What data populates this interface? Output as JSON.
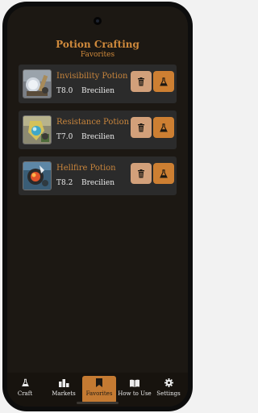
{
  "header": {
    "title": "Potion Crafting",
    "subtitle": "Favorites"
  },
  "favorites": [
    {
      "name": "Invisibility Potion",
      "tier": "T8.0",
      "city": "Brecilien",
      "icon": "invisibility-potion-icon"
    },
    {
      "name": "Resistance Potion",
      "tier": "T7.0",
      "city": "Brecilien",
      "icon": "resistance-potion-icon"
    },
    {
      "name": "Hellfire Potion",
      "tier": "T8.2",
      "city": "Brecilien",
      "icon": "hellfire-potion-icon"
    }
  ],
  "nav": {
    "items": [
      {
        "label": "Craft",
        "icon": "flask-icon"
      },
      {
        "label": "Markets",
        "icon": "bar-chart-icon"
      },
      {
        "label": "Favorites",
        "icon": "bookmark-icon",
        "active": true
      },
      {
        "label": "How to Use",
        "icon": "book-icon"
      },
      {
        "label": "Settings",
        "icon": "gear-icon"
      }
    ]
  },
  "colors": {
    "accent": "#cd7f32",
    "accent_light": "#d2a07a",
    "background": "#1c1813",
    "card": "#2b2b2b",
    "title": "#d08a3c"
  }
}
